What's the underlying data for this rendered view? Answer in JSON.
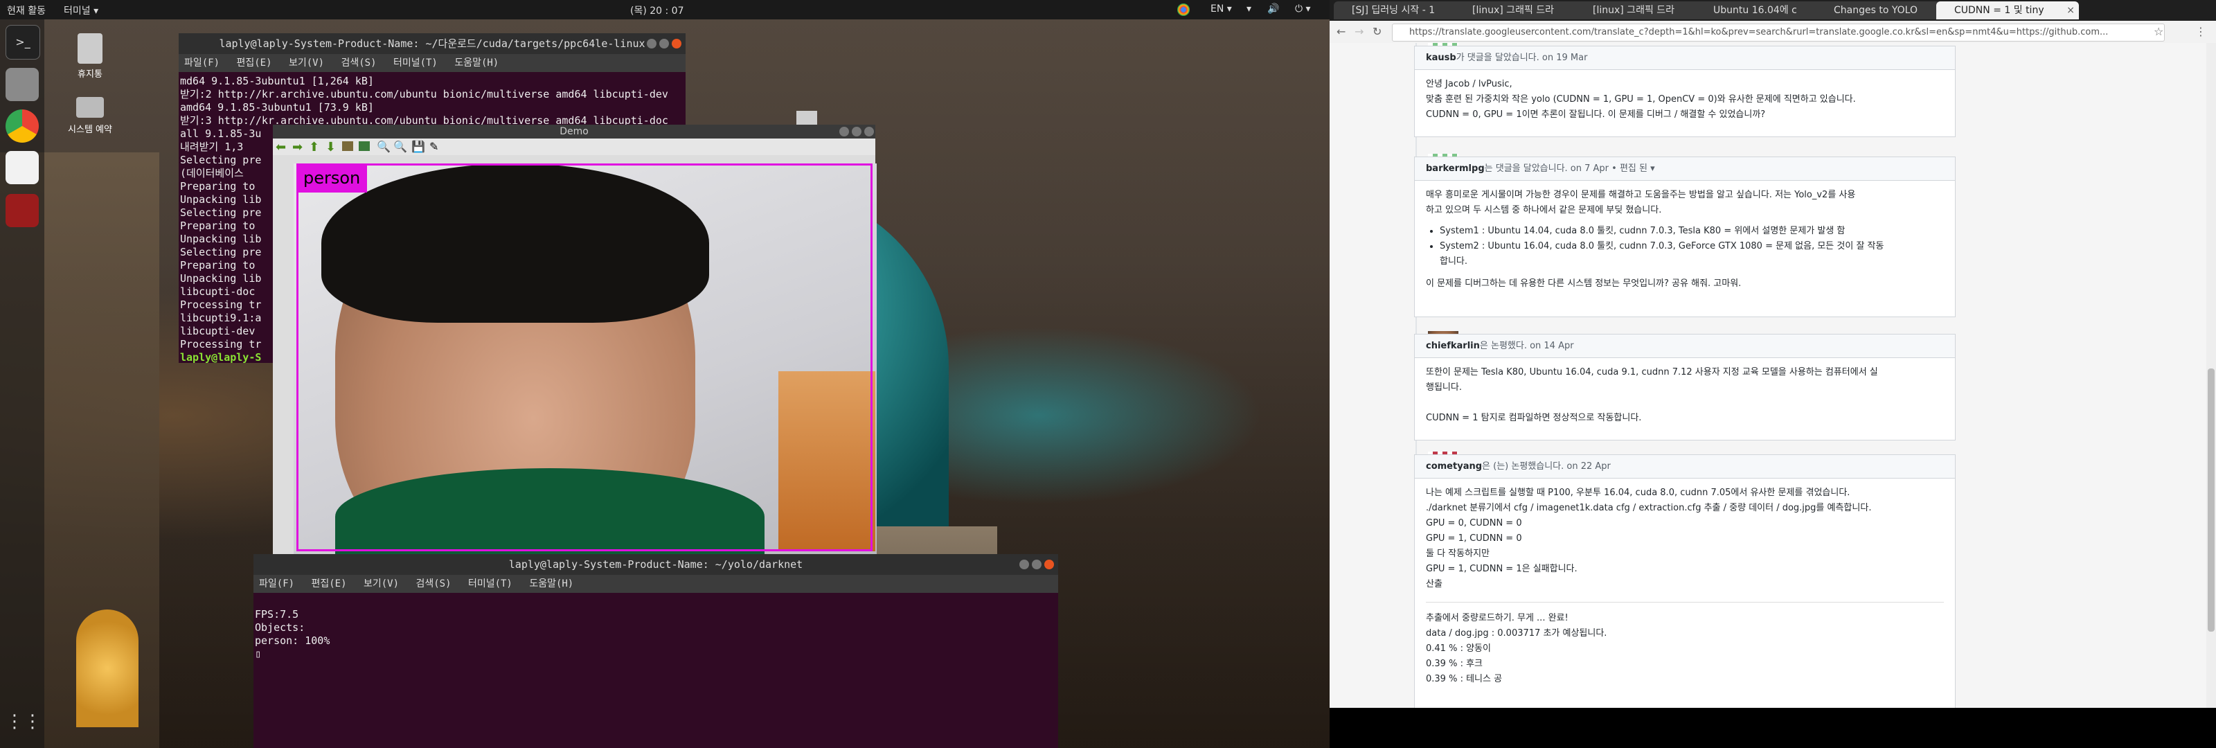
{
  "topbar": {
    "activities": "현재 활동",
    "app_menu": "터미널 ▾",
    "clock": "(목) 20 : 07",
    "lang": "EN ▾"
  },
  "desktop_icons": [
    {
      "label": "휴지통"
    },
    {
      "label": "시스템 예약"
    }
  ],
  "term1": {
    "title": "laply@laply-System-Product-Name: ~/다운로드/cuda/targets/ppc64le-linux",
    "menu": [
      "파일(F)",
      "편집(E)",
      "보기(V)",
      "검색(S)",
      "터미널(T)",
      "도움말(H)"
    ],
    "lines": [
      "md64 9.1.85-3ubuntu1 [1,264 kB]",
      "받기:2 http://kr.archive.ubuntu.com/ubuntu bionic/multiverse amd64 libcupti-dev",
      "amd64 9.1.85-3ubuntu1 [73.9 kB]",
      "받기:3 http://kr.archive.ubuntu.com/ubuntu bionic/multiverse amd64 libcupti-doc",
      "all 9.1.85-3u",
      "내려받기 1,3",
      "Selecting pre",
      "(데이터베이스",
      "Preparing to",
      "Unpacking lib",
      "Selecting pre",
      "Preparing to",
      "Unpacking lib",
      "Selecting pre",
      "Preparing to",
      "Unpacking lib",
      "libcupti-doc",
      "Processing tr",
      "libcupti9.1:a",
      "libcupti-dev",
      "Processing tr"
    ],
    "prompt": "laply@laply-S"
  },
  "demo": {
    "title": "Demo",
    "label": "person"
  },
  "term2": {
    "title": "laply@laply-System-Product-Name: ~/yolo/darknet",
    "menu": [
      "파일(F)",
      "편집(E)",
      "보기(V)",
      "검색(S)",
      "터미널(T)",
      "도움말(H)"
    ],
    "lines": [
      "FPS:7.5",
      "Objects:",
      "",
      "person: 100%"
    ]
  },
  "browser": {
    "tabs": [
      {
        "label": "[SJ] 딥러닝 시작 - 1"
      },
      {
        "label": "[linux] 그래픽 드라"
      },
      {
        "label": "[linux] 그래픽 드라"
      },
      {
        "label": "Ubuntu 16.04에 c"
      },
      {
        "label": "Changes to YOLO"
      },
      {
        "label": "CUDNN = 1 및 tiny"
      }
    ],
    "url": "https://translate.googleusercontent.com/translate_c?depth=1&hl=ko&prev=search&rurl=translate.google.co.kr&sl=en&sp=nmt4&u=https://github.com..."
  },
  "comments": [
    {
      "author": "kausb",
      "meta": "가 댓글을 달았습니다. on 19 Mar",
      "body": [
        "안녕 Jacob / lvPusic,",
        "맞춤 훈련 된 가중치와 작은 yolo (CUDNN = 1, GPU = 1, OpenCV = 0)와 유사한 문제에 직면하고 있습니다.",
        "CUDNN = 0, GPU = 1이면 추론이 잘됩니다. 이 문제를 디버그 / 해결할 수 있었습니까?"
      ]
    },
    {
      "author": "barkermlpg",
      "meta": "는 댓글을 달았습니다. on 7 Apr • 편집 된 ▾",
      "body": [
        "매우 흥미로운 게시물이며 가능한 경우이 문제를 해결하고 도움을주는 방법을 알고 싶습니다. 저는 Yolo_v2를 사용",
        "하고 있으며 두 시스템 중 하나에서 같은 문제에 부딪 혔습니다."
      ],
      "bullets": [
        "System1 : Ubuntu 14.04, cuda 8.0 툴킷, cudnn 7.0.3, Tesla K80 = 위에서 설명한 문제가 발생 함",
        "System2 : Ubuntu 16.04, cuda 8.0 툴킷, cudnn 7.0.3, GeForce GTX 1080 = 문제 없음, 모든 것이 잘 작동",
        "합니다."
      ],
      "footer": "이 문제를 디버그하는 데 유용한 다른 시스템 정보는 무엇입니까? 공유 해줘. 고마워."
    },
    {
      "author": "chiefkarlin",
      "meta": "은 논평했다. on 14 Apr",
      "body": [
        "또한이 문제는 Tesla K80, Ubuntu 16.04, cuda 9.1, cudnn 7.12 사용자 지정 교육 모델을 사용하는 컴퓨터에서 실",
        "행됩니다.",
        "",
        "CUDNN = 1 탐지로 컴파일하면 정상적으로 작동합니다."
      ]
    },
    {
      "author": "cometyang",
      "meta": "은 (는) 논평했습니다. on 22 Apr",
      "body": [
        "나는 예제 스크립트를 실행할 때 P100, 우분투 16.04, cuda 8.0, cudnn 7.05에서 유사한 문제를 겪었습니다.",
        "./darknet 분류기에서 cfg / imagenet1k.data cfg / extraction.cfg 추출 / 중량 데이터 / dog.jpg를 예측합니다.",
        "GPU = 0, CUDNN = 0",
        "GPU = 1, CUDNN = 0",
        "둘 다 작동하지만",
        "GPU = 1, CUDNN = 1은 실패합니다.",
        "산출"
      ],
      "output": [
        "추출에서 중량로드하기. 무게 ... 완료!",
        "data / dog.jpg : 0.003717 초가 예상됩니다.",
        "0.41 % : 양동이",
        "0.39 % : 후크",
        "0.39 % : 테니스 공"
      ]
    }
  ]
}
